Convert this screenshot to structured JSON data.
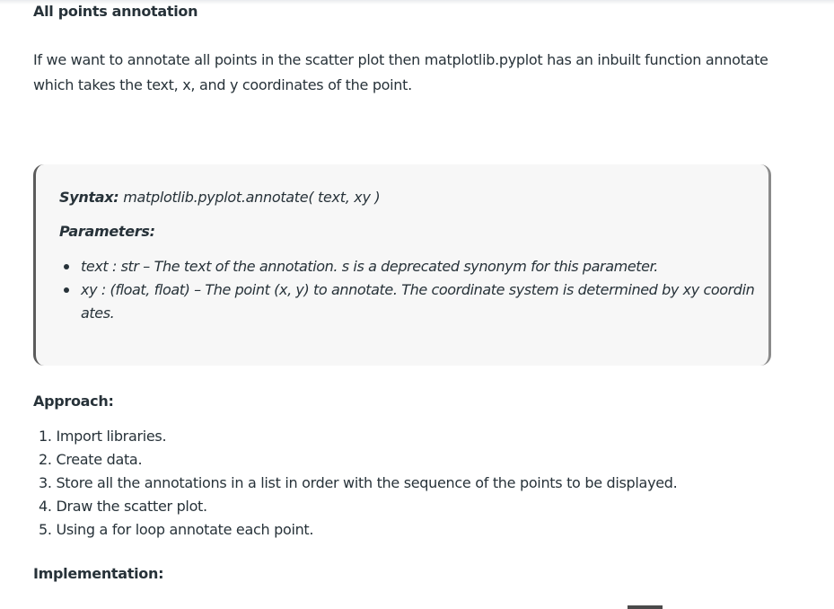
{
  "heading": "All points annotation",
  "intro": "If we want to annotate all points in the scatter plot then matplotlib.pyplot has an inbuilt function annotate which takes the text, x, and y coordinates of the point.",
  "syntax": {
    "label": "Syntax:",
    "value": " matplotlib.pyplot.annotate( text, xy )"
  },
  "parameters_label": "Parameters:",
  "parameters": [
    "text : str – The text of the annotation. s is a deprecated synonym for this parameter.",
    "xy : (float, float) – The point (x, y) to annotate. The coordinate system is determined by xy coordin ates."
  ],
  "approach_label": "Approach:",
  "steps": [
    "1. Import libraries.",
    "2. Create data.",
    "3. Store all the annotations in a list in order with the sequence of the points to be displayed.",
    "4. Draw the scatter plot.",
    "5. Using a for loop annotate each point."
  ],
  "implementation_label": "Implementation:"
}
